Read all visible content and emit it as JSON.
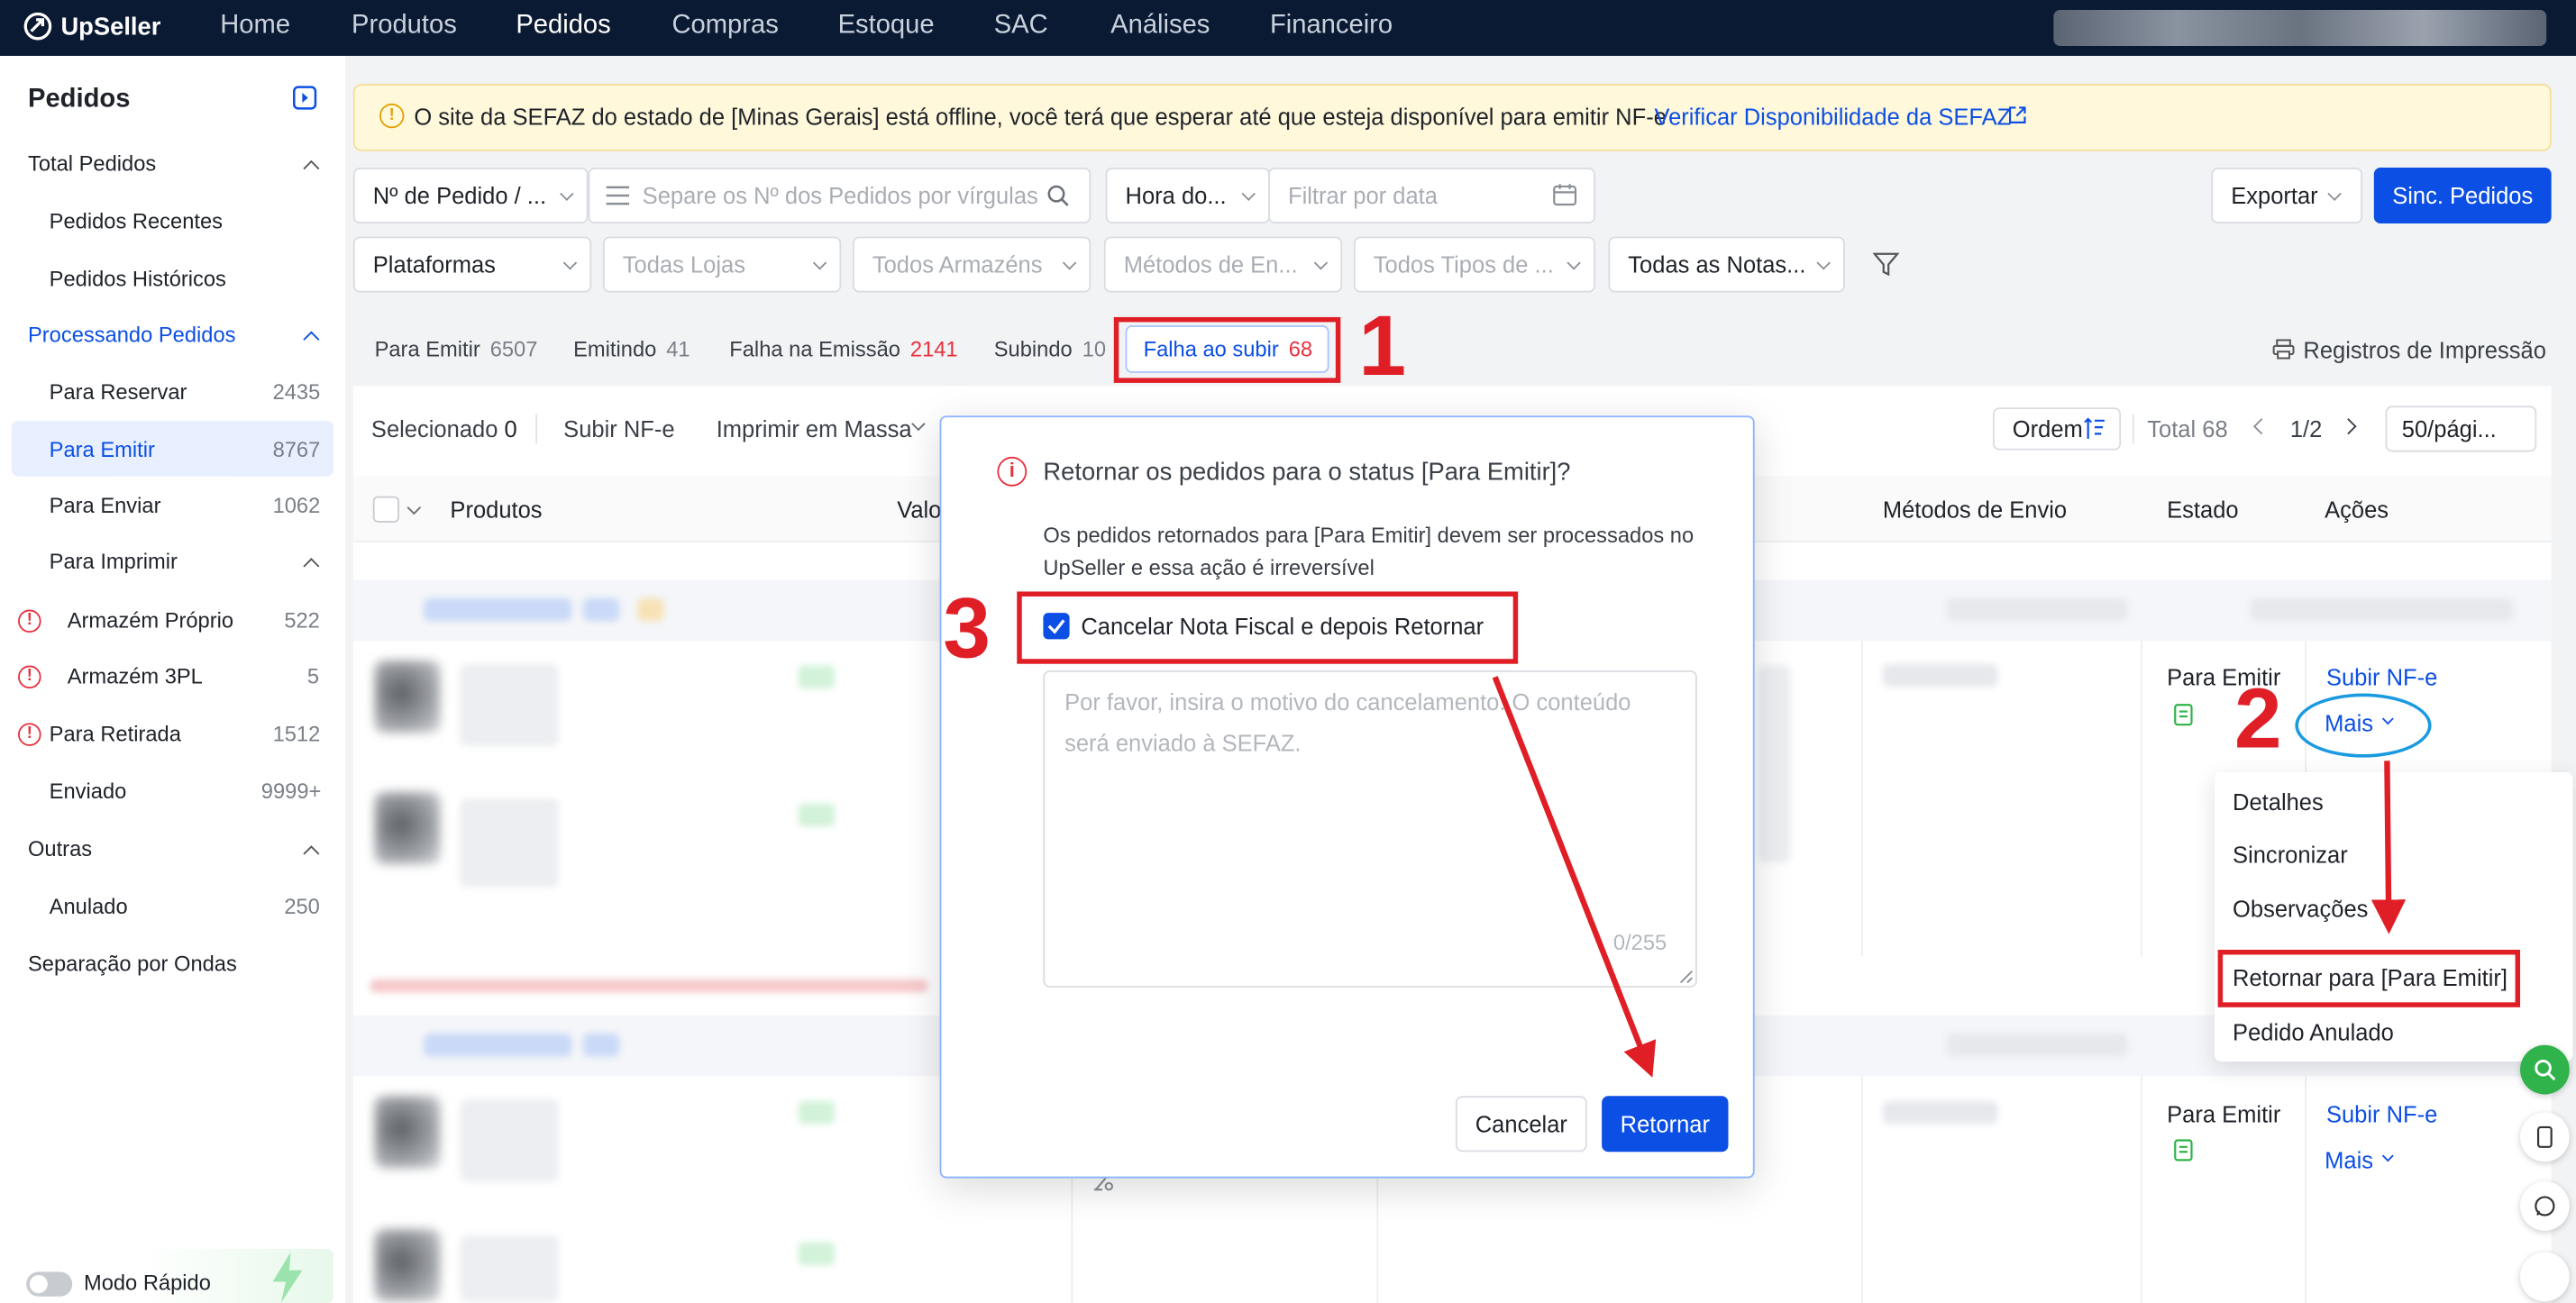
{
  "app": {
    "brand": "UpSeller"
  },
  "nav": [
    "Home",
    "Produtos",
    "Pedidos",
    "Compras",
    "Estoque",
    "SAC",
    "Análises",
    "Financeiro"
  ],
  "sidebar": {
    "title": "Pedidos",
    "total_pedidos": "Total Pedidos",
    "pedidos_recentes": "Pedidos Recentes",
    "pedidos_historicos": "Pedidos Históricos",
    "processando": "Processando Pedidos",
    "items": [
      {
        "label": "Para Reservar",
        "count": "2435"
      },
      {
        "label": "Para Emitir",
        "count": "8767"
      },
      {
        "label": "Para Enviar",
        "count": "1062"
      }
    ],
    "para_imprimir": "Para Imprimir",
    "print_items": [
      {
        "label": "Armazém Próprio",
        "count": "522"
      },
      {
        "label": "Armazém 3PL",
        "count": "5"
      },
      {
        "label": "Para Retirada",
        "count": "1512"
      },
      {
        "label": "Enviado",
        "count": "9999+"
      }
    ],
    "outras": "Outras",
    "anulado": {
      "label": "Anulado",
      "count": "250"
    },
    "separacao": "Separação por Ondas",
    "modo_rapido": "Modo Rápido"
  },
  "banner": {
    "text": "O site da SEFAZ do estado de [Minas Gerais] está offline, você terá que esperar até que esteja disponível para emitir NF-e",
    "link": "Verificar Disponibilidade da SEFAZ"
  },
  "filters": {
    "order_no": "Nº de Pedido / ...",
    "order_placeholder": "Separe os Nº dos Pedidos por vírgulas",
    "hora": "Hora do...",
    "date_placeholder": "Filtrar por data",
    "exportar": "Exportar",
    "sinc": "Sinc. Pedidos",
    "plataformas": "Plataformas",
    "lojas": "Todas Lojas",
    "armazens": "Todos Armazéns",
    "metodos": "Métodos de En...",
    "tipos": "Todos Tipos de ...",
    "notas": "Todas as Notas..."
  },
  "tabs": [
    {
      "label": "Para Emitir",
      "count": "6507"
    },
    {
      "label": "Emitindo",
      "count": "41"
    },
    {
      "label": "Falha na Emissão",
      "count": "2141"
    },
    {
      "label": "Subindo",
      "count": "10"
    },
    {
      "label": "Falha ao subir",
      "count": "68"
    }
  ],
  "registros": "Registros de Impressão",
  "toolbar": {
    "selecionado": "Selecionado",
    "sel_count": "0",
    "subir": "Subir NF-e",
    "imprimir": "Imprimir em Massa",
    "ordem": "Ordem",
    "total": "Total 68",
    "page": "1/2",
    "per_page": "50/pági..."
  },
  "columns": {
    "produtos": "Produtos",
    "valor": "Valo",
    "metodos": "Métodos de Envio",
    "estado": "Estado",
    "acoes": "Ações"
  },
  "rows": [
    {
      "estado": "Para Emitir",
      "subir": "Subir NF-e",
      "mais": "Mais"
    },
    {
      "estado": "Para Emitir",
      "subir": "Subir NF-e",
      "mais": "Mais"
    }
  ],
  "menu": [
    "Detalhes",
    "Sincronizar",
    "Observações",
    "Retornar para [Para Emitir]",
    "Pedido Anulado"
  ],
  "dialog": {
    "title": "Retornar os pedidos para o status [Para Emitir]?",
    "body": "Os pedidos retornados para [Para Emitir] devem ser processados no UpSeller e essa ação é irreversível",
    "checkbox": "Cancelar Nota Fiscal e depois Retornar",
    "textarea_placeholder": "Por favor, insira o motivo do cancelamento. O conteúdo será enviado à SEFAZ.",
    "counter": "0/255",
    "cancel": "Cancelar",
    "confirm": "Retornar"
  },
  "annotations": [
    "1",
    "2",
    "3"
  ],
  "colors": {
    "primary": "#0c4fe4",
    "annotation": "#e01e26",
    "circle": "#1a9ae0",
    "danger": "#e8303c"
  }
}
